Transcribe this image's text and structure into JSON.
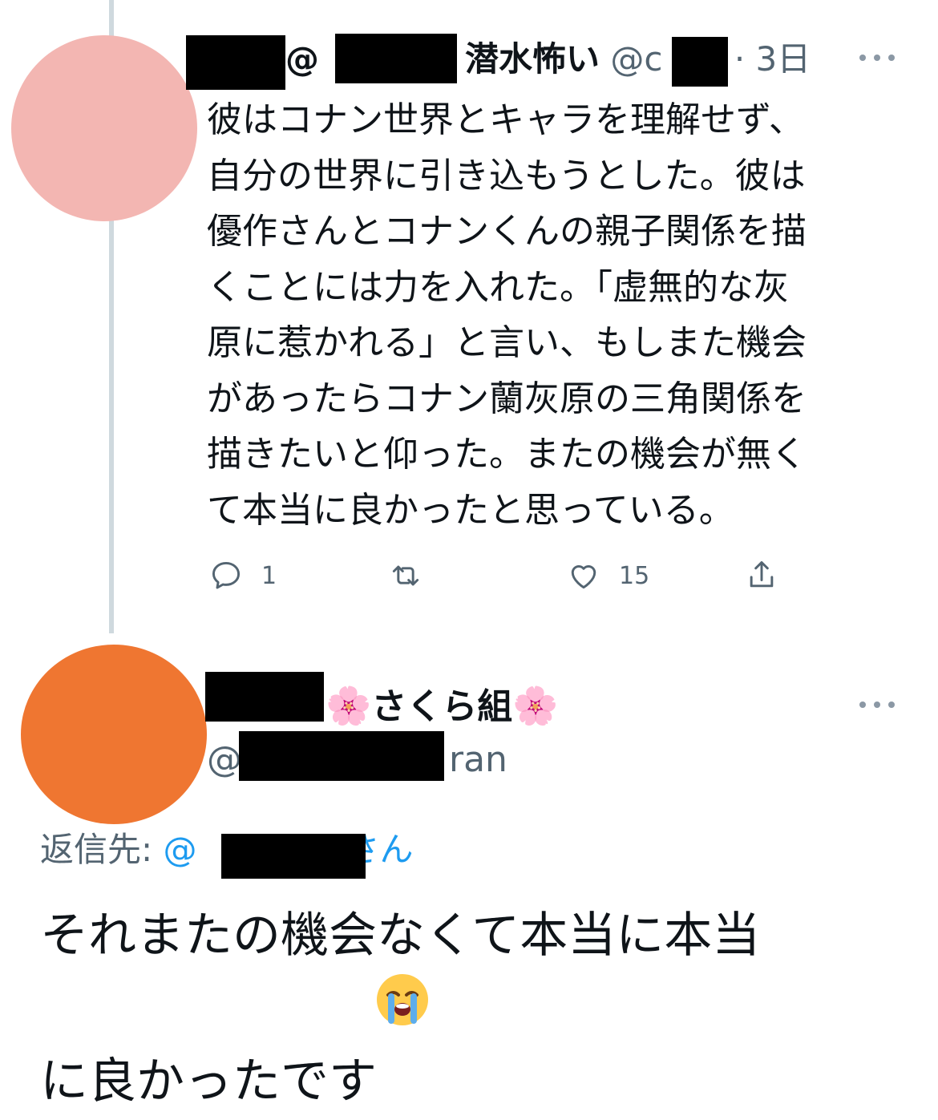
{
  "tweet1": {
    "name_visible": "@",
    "name_suffix": "潜水怖い",
    "handle_start": "@c",
    "handle_tail": ".",
    "time": "· 3日",
    "body": "彼はコナン世界とキャラを理解せず、\n自分の世界に引き込もうとした。彼は\n優作さんとコナンくんの親子関係を描\nくことには力を入れた。「虚無的な灰\n原に惹かれる」と言い、もしまた機会\nがあったらコナン蘭灰原の三角関係を\n描きたいと仰った。またの機会が無く\nて本当に良かったと思っている。",
    "actions": {
      "reply_count": "1",
      "retweet_count": "",
      "like_count": "15"
    }
  },
  "tweet2": {
    "name": "さくら組",
    "name_emoji": "🌸",
    "handle_prefix": "@",
    "handle_suffix": "ran",
    "reply_label": "返信先: ",
    "reply_at": "@",
    "reply_san": "さん",
    "body": "それまたの機会なくて本当に本当\nに良かったです",
    "body_emoji": "😭"
  },
  "icons": {
    "more": "more-horizontal-icon",
    "reply": "reply-bubble-icon",
    "retweet": "retweet-icon",
    "like": "heart-icon",
    "share": "share-icon"
  },
  "colors": {
    "text": "#0f1419",
    "secondary": "#536471",
    "link": "#1d9bf0",
    "thread_line": "#cfd9de",
    "avatar1": "#f3b6b2",
    "avatar2": "#ef7631"
  }
}
